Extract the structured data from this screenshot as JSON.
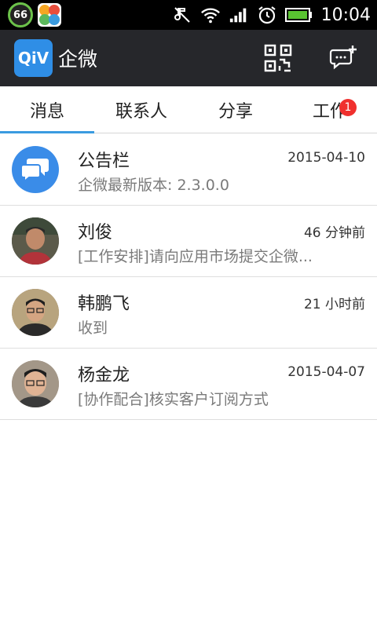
{
  "status_bar": {
    "battery_circle": "66",
    "time": "10:04",
    "icons": [
      "no-music-icon",
      "wifi-icon",
      "signal-icon",
      "alarm-icon",
      "battery-icon"
    ]
  },
  "app_bar": {
    "logo_text": "QiV",
    "title": "企微",
    "actions": [
      "qr-code-icon",
      "chat-add-icon"
    ]
  },
  "tabs": [
    {
      "label": "消息",
      "active": true
    },
    {
      "label": "联系人"
    },
    {
      "label": "分享"
    },
    {
      "label": "工作",
      "badge": "1"
    }
  ],
  "messages": [
    {
      "name": "公告栏",
      "time": "2015-04-10",
      "preview": "企微最新版本: 2.3.0.0",
      "avatar": "announcement-icon"
    },
    {
      "name": "刘俊",
      "time": "46 分钟前",
      "preview": "[工作安排]请向应用市场提交企微...",
      "avatar": "user-photo"
    },
    {
      "name": "韩鹏飞",
      "time": "21 小时前",
      "preview": "收到",
      "avatar": "user-photo"
    },
    {
      "name": "杨金龙",
      "time": "2015-04-07",
      "preview": "[协作配合]核实客户订阅方式",
      "avatar": "user-photo"
    }
  ],
  "colors": {
    "app_bar": "#26272b",
    "accent": "#3a9be0",
    "badge": "#f0302e",
    "logo": "#2f8ee6"
  }
}
